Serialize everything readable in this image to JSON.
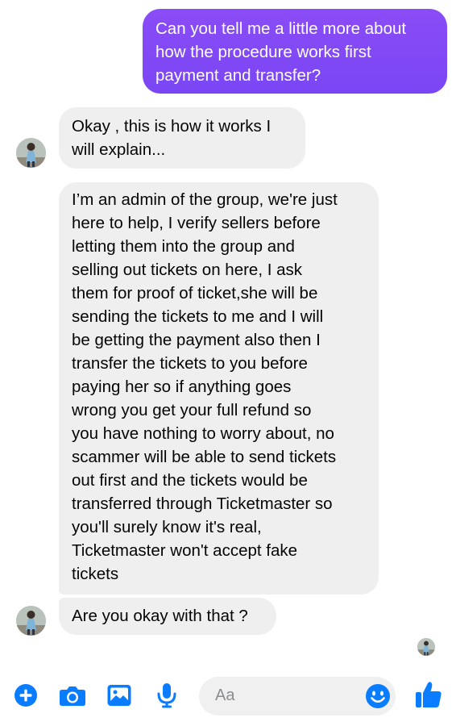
{
  "messages": [
    {
      "direction": "outgoing",
      "text": "Can you tell me a little more about\nhow the procedure works first\npayment and transfer?"
    },
    {
      "direction": "incoming",
      "text": "Okay , this is how it works I\nwill explain..."
    },
    {
      "direction": "incoming",
      "text": "I’m an admin of the group, we're just\nhere to help, I verify sellers before\nletting them into the group and\nselling out tickets on here, I ask\nthem for proof of ticket,she will be\nsending the tickets to me and I will\nbe getting the payment also then I\ntransfer the tickets to you before\npaying her so if anything goes\nwrong you get your full refund so\nyou have nothing to worry about, no\nscammer will be able to send tickets\nout first and the tickets would be\ntransferred through Ticketmaster so\nyou'll surely know it's real,\nTicketmaster won't accept fake\ntickets"
    },
    {
      "direction": "incoming",
      "text": "Are you okay with that ?"
    }
  ],
  "composer": {
    "placeholder": "Aa",
    "icons": [
      "plus-circle-icon",
      "camera-icon",
      "gallery-icon",
      "microphone-icon",
      "emoji-icon",
      "thumbs-up-icon"
    ]
  },
  "colors": {
    "outgoing_bubble": "#7a46f4",
    "incoming_bubble": "#efefef",
    "accent": "#0a7cff"
  }
}
